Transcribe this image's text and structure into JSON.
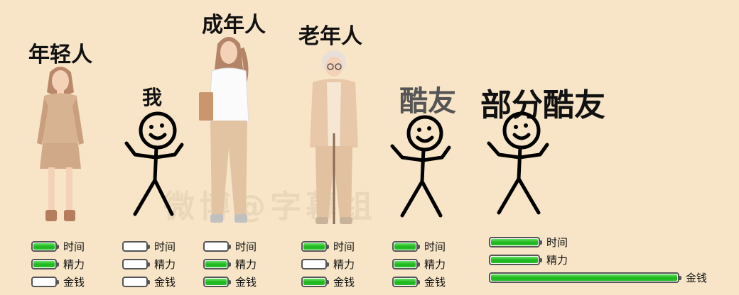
{
  "colors": {
    "background": "#f8e5c7",
    "battery_fill": "#27c327",
    "battery_border": "#555555"
  },
  "labels": {
    "time": "时间",
    "energy": "精力",
    "money": "金钱"
  },
  "watermark": "微博@字幕组",
  "columns": [
    {
      "title": "年轻人",
      "figure": "young-woman-figure",
      "time": 1.0,
      "energy": 1.0,
      "money": 0.0
    },
    {
      "title": "我",
      "figure": "stick-figure",
      "time": 0.0,
      "energy": 0.0,
      "money": 0.0
    },
    {
      "title": "成年人",
      "figure": "adult-woman-figure",
      "time": 0.0,
      "energy": 1.0,
      "money": 1.0
    },
    {
      "title": "老年人",
      "figure": "elderly-woman-figure",
      "time": 1.0,
      "energy": 0.0,
      "money": 1.0
    },
    {
      "title": "酷友",
      "figure": "stick-figure",
      "time": 1.0,
      "energy": 1.0,
      "money": 1.0
    },
    {
      "title": "部分酷友",
      "figure": "stick-figure",
      "time": 1.0,
      "energy": 1.0,
      "money": 1.0
    }
  ]
}
